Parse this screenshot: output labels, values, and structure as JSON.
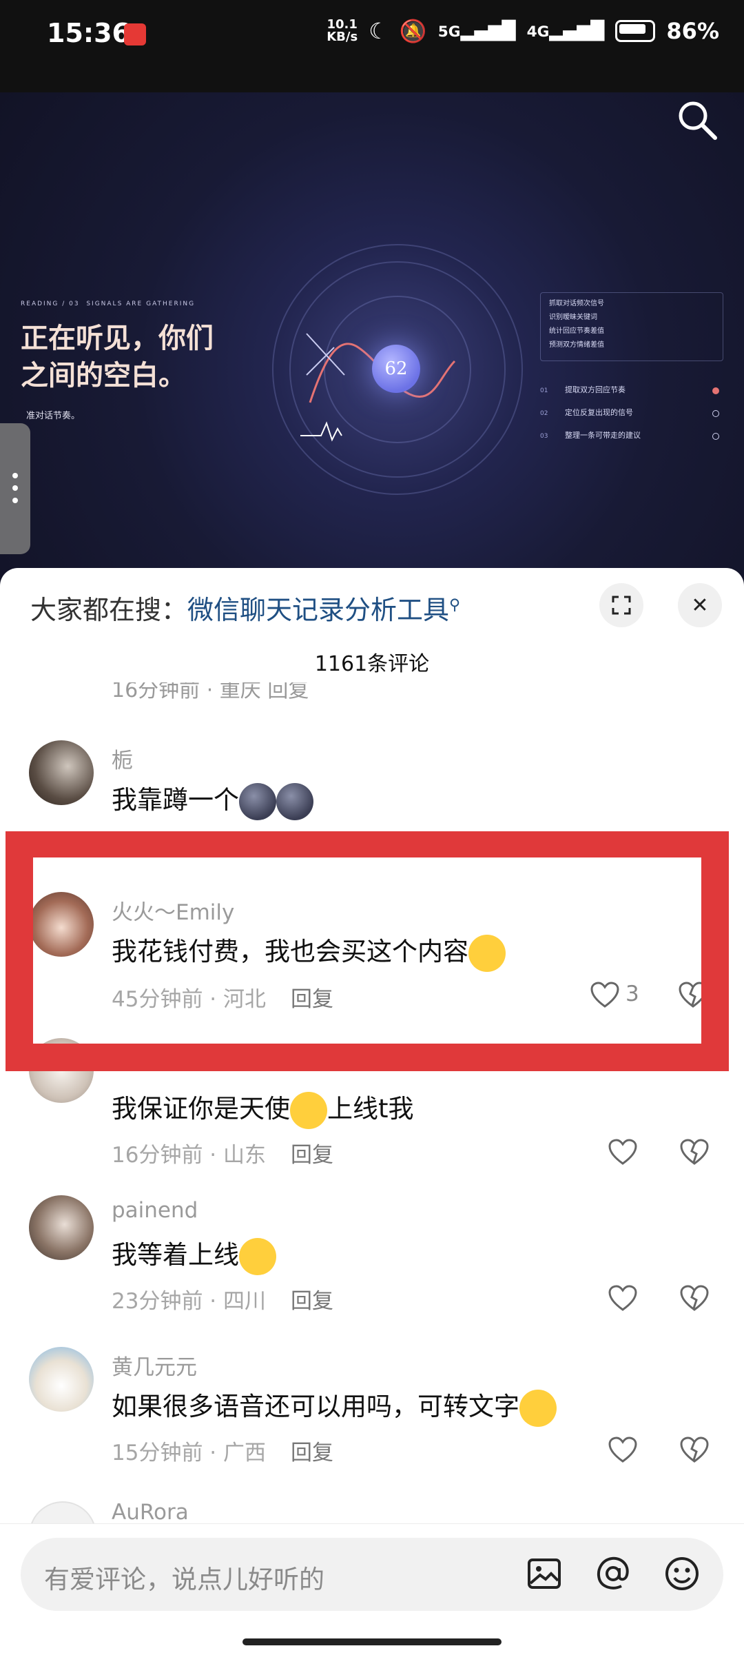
{
  "status_bar": {
    "time": "15:36",
    "net_speed": "10.1",
    "net_unit": "KB/s",
    "signal_5g": "5G",
    "signal_4g": "4G",
    "battery": "86%"
  },
  "video": {
    "small_label": "READING / 03",
    "small_label_2": "SIGNALS ARE GATHERING",
    "headline_1": "正在听见，你们",
    "headline_2": "之间的空白。",
    "sub": "准对话节奏。",
    "orb_value": "62",
    "panel_items": [
      "抓取对话频次信号",
      "识别暧昧关键词",
      "统计回应节奏差值",
      "预测双方情绪差值"
    ],
    "steps": [
      {
        "num": "01",
        "label": "提取双方回应节奏"
      },
      {
        "num": "02",
        "label": "定位反复出现的信号"
      },
      {
        "num": "03",
        "label": "整理一条可带走的建议"
      }
    ]
  },
  "sheet": {
    "search_prefix": "大家都在搜：",
    "search_term": "微信聊天记录分析工具",
    "comment_count": "1161条评论",
    "cut_meta": "16分钟前 · 重庆  回复"
  },
  "comments": [
    {
      "user": "栀",
      "text": "我靠蹲一个",
      "meta_time": "",
      "meta_place": "",
      "reply": ""
    },
    {
      "user": "火火～Emily",
      "text": "我花钱付费，我也会买这个内容",
      "meta_time": "45分钟前",
      "meta_place": "河北",
      "reply": "回复",
      "likes": "3"
    },
    {
      "user": "",
      "text": "我保证你是天使",
      "text_2": "上线t我",
      "meta_time": "16分钟前",
      "meta_place": "山东",
      "reply": "回复"
    },
    {
      "user": "painend",
      "text": "我等着上线",
      "meta_time": "23分钟前",
      "meta_place": "四川",
      "reply": "回复"
    },
    {
      "user": "黄几元元",
      "text": "如果很多语音还可以用吗，可转文字",
      "meta_time": "15分钟前",
      "meta_place": "广西",
      "reply": "回复"
    },
    {
      "user": "AuRora"
    }
  ],
  "input": {
    "placeholder": "有爱评论，说点儿好听的"
  },
  "colors": {
    "highlight": "#e0393a",
    "search_term": "#1f4f83"
  }
}
